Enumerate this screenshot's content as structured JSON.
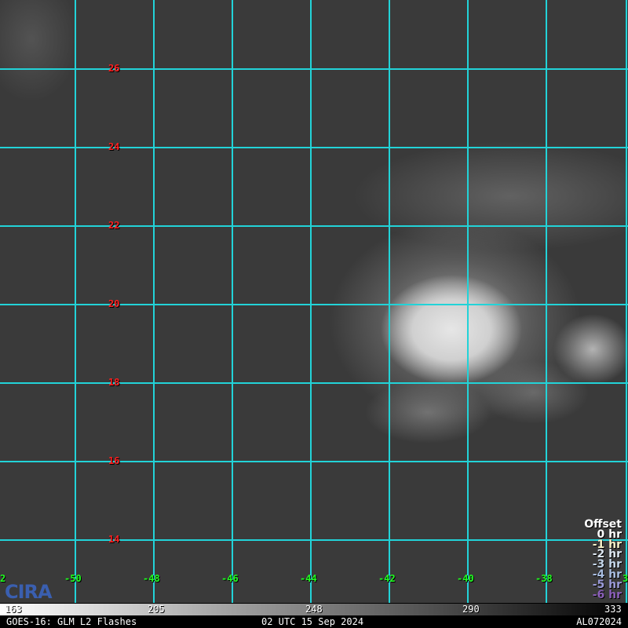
{
  "grid": {
    "latitudes": [
      "26",
      "24",
      "22",
      "20",
      "18",
      "16",
      "14"
    ],
    "longitudes": [
      "2",
      "-50",
      "-48",
      "-46",
      "-44",
      "-42",
      "-40",
      "-38",
      "3"
    ],
    "line_color": "#22d3d8",
    "lat_label_color": "#ff2020",
    "lon_label_color": "#20ff20"
  },
  "legend": {
    "title": "Offset",
    "items": [
      {
        "label": "0 hr",
        "color": "#ffffff"
      },
      {
        "label": "-1 hr",
        "color": "#f5f0c8"
      },
      {
        "label": "-2 hr",
        "color": "#dde6f0"
      },
      {
        "label": "-3 hr",
        "color": "#c4d6ea"
      },
      {
        "label": "-4 hr",
        "color": "#a8bde0"
      },
      {
        "label": "-5 hr",
        "color": "#9a9ad8"
      },
      {
        "label": "-6 hr",
        "color": "#8a5fb8"
      }
    ]
  },
  "logo": "CIRA",
  "colorbar": {
    "ticks": [
      "163",
      "205",
      "248",
      "290",
      "333"
    ]
  },
  "footer": {
    "left": "GOES-16: GLM L2 Flashes",
    "center": "02 UTC 15 Sep 2024",
    "right": "AL072024"
  }
}
